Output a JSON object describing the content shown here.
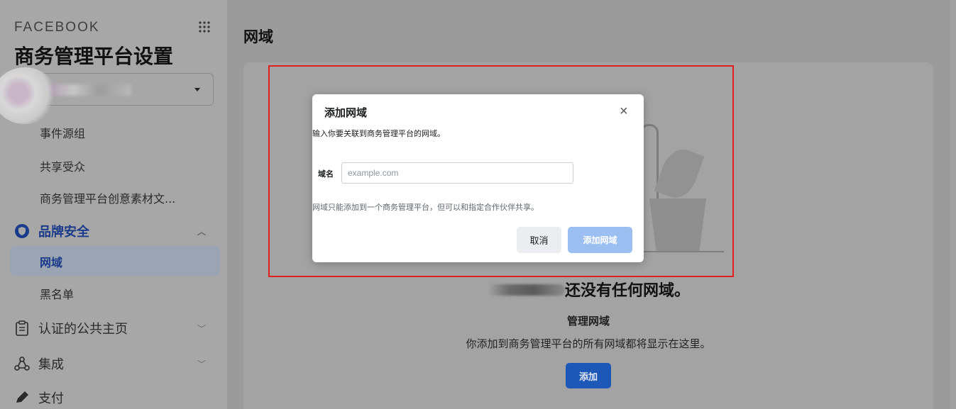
{
  "sidebar": {
    "brand": "FACEBOOK",
    "heading": "商务管理平台设置",
    "nav_items": {
      "event_groups": "事件源组",
      "shared_audiences": "共享受众",
      "creative_library": "商务管理平台创意素材文..."
    },
    "brand_safety": {
      "label": "品牌安全",
      "items": {
        "domains": "网域",
        "blocklist": "黑名单"
      }
    },
    "verified_pages": "认证的公共主页",
    "integrations": "集成",
    "payments": "支付"
  },
  "main": {
    "title": "网域",
    "empty_state": {
      "title": "还没有任何网域。",
      "subtitle": "管理网域",
      "description": "你添加到商务管理平台的所有网域都将显示在这里。",
      "add_button": "添加"
    }
  },
  "modal": {
    "title": "添加网域",
    "close": "×",
    "description": "输入你要关联到商务管理平台的网域。",
    "field_label": "域名",
    "input_placeholder": "example.com",
    "input_value": "",
    "note": "网域只能添加到一个商务管理平台，但可以和指定合作伙伴共享。",
    "cancel_button": "取消",
    "confirm_button": "添加网域"
  },
  "colors": {
    "primary": "#1d57b8",
    "primary_disabled": "#9cbff2",
    "highlight": "#e02020",
    "active_nav_text": "#1a3a8a"
  },
  "icons": {
    "apps": "grid-dots-icon",
    "brand_safety": "shield-icon",
    "verified_pages": "clipboard-icon",
    "integrations": "network-icon",
    "payments": "pencil-icon"
  }
}
